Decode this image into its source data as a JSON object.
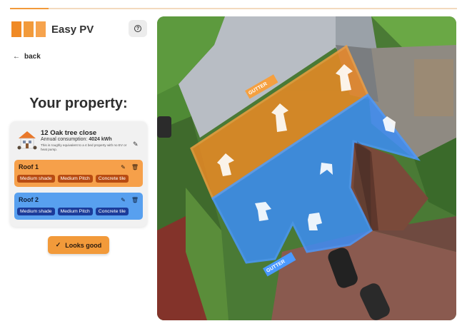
{
  "progress": {
    "fraction": 0.087
  },
  "brand": {
    "name": "Easy PV"
  },
  "nav": {
    "back_label": "back"
  },
  "page": {
    "title": "Your property:"
  },
  "property": {
    "address": "12 Oak tree close",
    "consumption_label": "Annual consumption:",
    "consumption_value": "4024 kWh",
    "equivalent_text": "This is roughly equivalent to a 4 bed property with no EV or heat pump."
  },
  "roofs": [
    {
      "title": "Roof 1",
      "tags": [
        "Medium shade",
        "Medium Pitch",
        "Concrete tile"
      ],
      "color": "#f6a04a"
    },
    {
      "title": "Roof 2",
      "tags": [
        "Medium shade",
        "Medium Pitch",
        "Concrete tile"
      ],
      "color": "#58a0ef"
    }
  ],
  "actions": {
    "confirm_label": "Looks good"
  },
  "map": {
    "gutter_label_1": "GUTTER",
    "gutter_label_2": "GUTTER"
  },
  "colors": {
    "accent": "#f29a3a",
    "roof_orange": "#f08a25",
    "roof_blue": "#3d8df5"
  }
}
